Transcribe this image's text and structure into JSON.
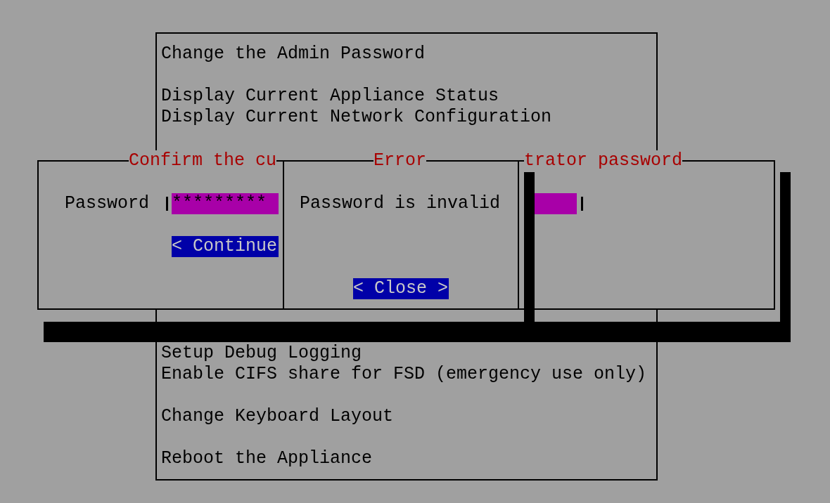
{
  "menu": {
    "top_groups": [
      [
        "Change the Admin Password"
      ],
      [
        "Display Current Appliance Status",
        "Display Current Network Configuration"
      ]
    ],
    "bottom_groups": [
      [
        "Setup Debug Logging",
        "Enable CIFS share for FSD (emergency use only)"
      ],
      [
        "Change Keyboard Layout"
      ],
      [
        "Reboot the Appliance"
      ]
    ]
  },
  "confirm_dialog": {
    "title_left": "Confirm the cu",
    "title_right": "trator password",
    "field_label": "Password",
    "field_value": "*********",
    "button": "< Continue"
  },
  "error_dialog": {
    "title": "Error",
    "message": "Password is invalid",
    "button": "< Close >"
  }
}
